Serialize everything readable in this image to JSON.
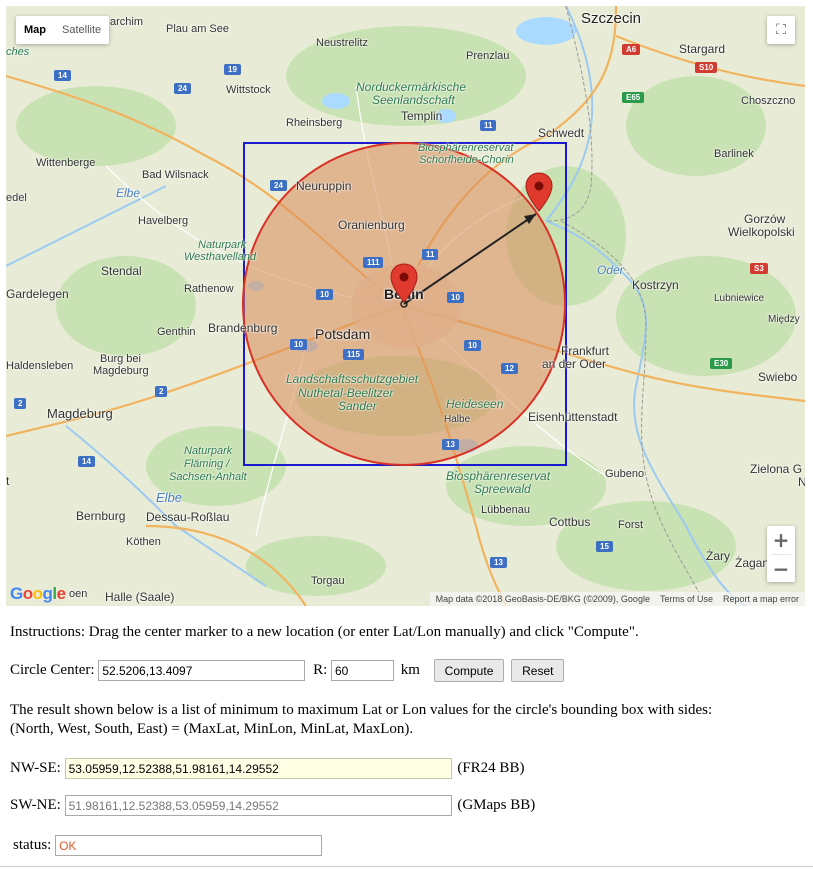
{
  "map": {
    "type_buttons": [
      "Map",
      "Satellite"
    ],
    "zoom_in": "+",
    "zoom_out": "−",
    "fullscreen_glyph": "⛶",
    "logo": "Google",
    "attribution": [
      "Map data ©2018 GeoBasis-DE/BKG (©2009), Google",
      "Terms of Use",
      "Report a map error"
    ],
    "labels": {
      "szczecin": "Szczecin",
      "stargard": "Stargard",
      "choszczno": "Choszczno",
      "schwedt": "Schwedt",
      "prenzlau": "Prenzlau",
      "neustrelitz": "Neustrelitz",
      "plau": "Plau am See",
      "archim": "archim",
      "ches": "ches",
      "wittstock": "Wittstock",
      "rheinsberg": "Rheinsberg",
      "templin": "Templin",
      "nordu": "Norduckermärkische",
      "nordu2": "Seenlandschaft",
      "biosph1": "Biosphärenreservat",
      "biosph1b": "Schorfheide-Chorin",
      "barlinek": "Barlinek",
      "wittenberge": "Wittenberge",
      "badwilsnack": "Bad Wilsnack",
      "elbe1": "Elbe",
      "edel": "edel",
      "neuruppin": "Neuruppin",
      "gorzow": "Gorzów",
      "gorzow2": "Wielkopolski",
      "havelberg": "Havelberg",
      "oranienburg": "Oranienburg",
      "naturpark1": "Naturpark",
      "naturpark1b": "Westhavelland",
      "stendal": "Stendal",
      "oder": "Oder",
      "kostrzyn": "Kostrzyn",
      "lubniewice": "Lubniewice",
      "gardelegen": "Gardelegen",
      "rathenow": "Rathenow",
      "berlin": "Berlin",
      "miedzy": "Między",
      "genthin": "Genthin",
      "brandenburg": "Brandenburg",
      "potsdam": "Potsdam",
      "frankfurt": "Frankfurt",
      "frankfurt2": "an der Oder",
      "haldensleben": "Haldensleben",
      "burg": "Burg bei",
      "burg2": "Magdeburg",
      "lsg1": "Landschaftsschutzgebiet",
      "lsg2": "Nuthetal-Beelitzer",
      "lsg3": "Sander",
      "swiebo": "Swiebo",
      "magdeburg": "Magdeburg",
      "heideseen": "Heideseen",
      "halbe": "Halbe",
      "eisenhuttenstadt": "Eisenhüttenstadt",
      "naturpark2": "Naturpark",
      "naturpark2b": "Fläming /",
      "naturpark2c": "Sachsen-Anhalt",
      "biosph2": "Biosphärenreservat",
      "biosph2b": "Spreewald",
      "gubeno": "Gubeno",
      "zielona": "Zielona G",
      "elbe2": "Elbe",
      "bernburg": "Bernburg",
      "dessau": "Dessau-Roßlau",
      "lubbenau": "Lübbenau",
      "cottbus": "Cottbus",
      "forst": "Forst",
      "kothen": "Köthen",
      "zary": "Żary",
      "zagan": "Żagan",
      "torgau": "Torgau",
      "halle": "Halle (Saale)",
      "oen": "oen",
      "t": "t",
      "n": "N"
    },
    "shields": {
      "a6": "A6",
      "s10": "S10",
      "e65": "E65",
      "s3": "S3",
      "e30": "E30",
      "r14a": "14",
      "r24a": "24",
      "r19": "19",
      "r11a": "11",
      "r24b": "24",
      "r111": "111",
      "r11b": "11",
      "r10a": "10",
      "r10b": "10",
      "r10c": "10",
      "r10d": "10",
      "r115": "115",
      "r12": "12",
      "r2a": "2",
      "r2b": "2",
      "r14b": "14",
      "r13a": "13",
      "r13b": "13",
      "r15": "15"
    }
  },
  "form": {
    "instructions": "Instructions: Drag the center marker to a new location (or enter Lat/Lon manually) and click \"Compute\".",
    "center_label": "Circle Center:",
    "center_value": "52.5206,13.4097",
    "r_label": "R:",
    "r_value": "60",
    "km_label": "km",
    "compute_label": "Compute",
    "reset_label": "Reset",
    "result_line1": "The result shown below is a list of minimum to maximum Lat or Lon values for the circle's bounding box with sides:",
    "result_line2": "(North, West, South, East) = (MaxLat, MinLon, MinLat, MaxLon).",
    "nwse_label": "NW-SE:",
    "nwse_value": "53.05959,12.52388,51.98161,14.29552",
    "nwse_suffix": "(FR24 BB)",
    "swne_label": "SW-NE:",
    "swne_value": "51.98161,12.52388,53.05959,14.29552",
    "swne_suffix": "(GMaps BB)",
    "status_label": "status:",
    "status_value": "OK"
  },
  "colors": {
    "circle_stroke": "#d93025",
    "circle_fill": "#d98a5a",
    "box_stroke": "#1a1ad0",
    "marker": "#e03a2f",
    "highway": "#e0523f",
    "federal_road": "#3d6fc4"
  }
}
